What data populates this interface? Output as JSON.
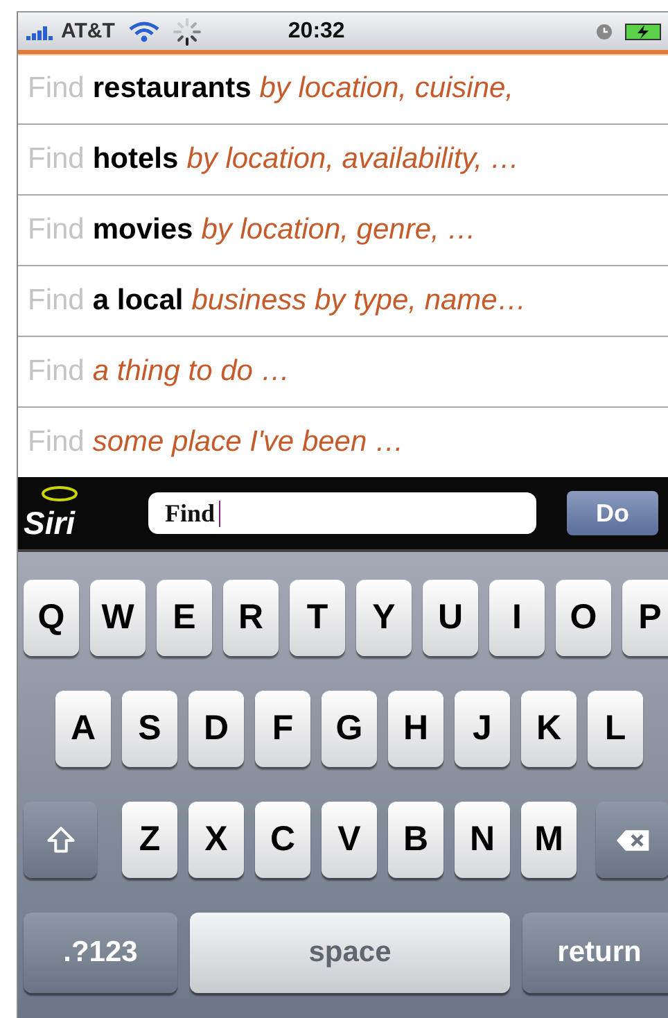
{
  "status_bar": {
    "carrier": "AT&T",
    "time": "20:32"
  },
  "suggestions": [
    {
      "prefix": "Find",
      "bold": "restaurants",
      "hint": "by location, cuisine,"
    },
    {
      "prefix": "Find",
      "bold": "hotels",
      "hint": "by location, availability, …"
    },
    {
      "prefix": "Find",
      "bold": "movies",
      "hint": "by location, genre,  …"
    },
    {
      "prefix": "Find",
      "bold": "a local",
      "hint": "business by type, name…"
    },
    {
      "prefix": "Find",
      "hint": "a thing to do …"
    },
    {
      "prefix": "Find",
      "hint": "some place I've been  …"
    }
  ],
  "search_bar": {
    "logo": "Siri",
    "value": "Find",
    "button": "Do"
  },
  "keyboard": [
    [
      {
        "kind": "letter",
        "label": "Q"
      },
      {
        "kind": "letter",
        "label": "W"
      },
      {
        "kind": "letter",
        "label": "E"
      },
      {
        "kind": "letter",
        "label": "R"
      },
      {
        "kind": "letter",
        "label": "T"
      },
      {
        "kind": "letter",
        "label": "Y"
      },
      {
        "kind": "letter",
        "label": "U"
      },
      {
        "kind": "letter",
        "label": "I"
      },
      {
        "kind": "letter",
        "label": "O"
      },
      {
        "kind": "letter",
        "label": "P"
      }
    ],
    [
      {
        "kind": "letter",
        "label": "A"
      },
      {
        "kind": "letter",
        "label": "S"
      },
      {
        "kind": "letter",
        "label": "D"
      },
      {
        "kind": "letter",
        "label": "F"
      },
      {
        "kind": "letter",
        "label": "G"
      },
      {
        "kind": "letter",
        "label": "H"
      },
      {
        "kind": "letter",
        "label": "J"
      },
      {
        "kind": "letter",
        "label": "K"
      },
      {
        "kind": "letter",
        "label": "L"
      }
    ],
    [
      {
        "kind": "shift"
      },
      {
        "kind": "letter",
        "label": "Z"
      },
      {
        "kind": "letter",
        "label": "X"
      },
      {
        "kind": "letter",
        "label": "C"
      },
      {
        "kind": "letter",
        "label": "V"
      },
      {
        "kind": "letter",
        "label": "B"
      },
      {
        "kind": "letter",
        "label": "N"
      },
      {
        "kind": "letter",
        "label": "M"
      },
      {
        "kind": "delete"
      }
    ],
    [
      {
        "kind": "mode",
        "label": ".?123"
      },
      {
        "kind": "space",
        "label": "space"
      },
      {
        "kind": "return",
        "label": "return"
      }
    ]
  ]
}
